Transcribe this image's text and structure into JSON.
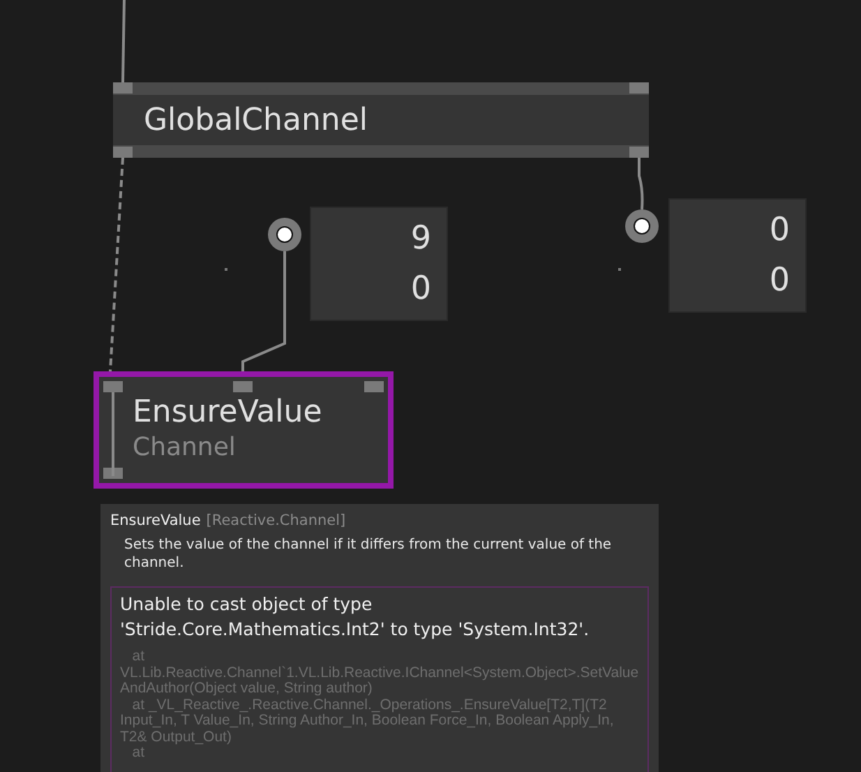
{
  "nodes": [
    {
      "kind": "process",
      "title": "GlobalChannel",
      "selected": false
    },
    {
      "kind": "process",
      "title": "EnsureValue",
      "category": "Channel",
      "selected": true
    }
  ],
  "ioboxes": [
    {
      "values": [
        "9",
        "0"
      ]
    },
    {
      "values": [
        "0",
        "0"
      ]
    }
  ],
  "tooltip": {
    "name": "EnsureValue",
    "namespace": "[Reactive.Channel]",
    "description": "Sets the value of the channel if it differs from the current value of the channel.",
    "error": {
      "message": "Unable to cast object of type 'Stride.Core.Mathematics.Int2' to type 'System.Int32'.",
      "stack_trace": "   at\nVL.Lib.Reactive.Channel`1.VL.Lib.Reactive.IChannel<System.Object>.SetValueAndAuthor(Object value, String author)\n   at _VL_Reactive_.Reactive.Channel._Operations_.EnsureValue[T2,T](T2 Input_In, T Value_In, String Author_In, Boolean Force_In, Boolean Apply_In, T2& Output_Out)\n   at"
    }
  }
}
